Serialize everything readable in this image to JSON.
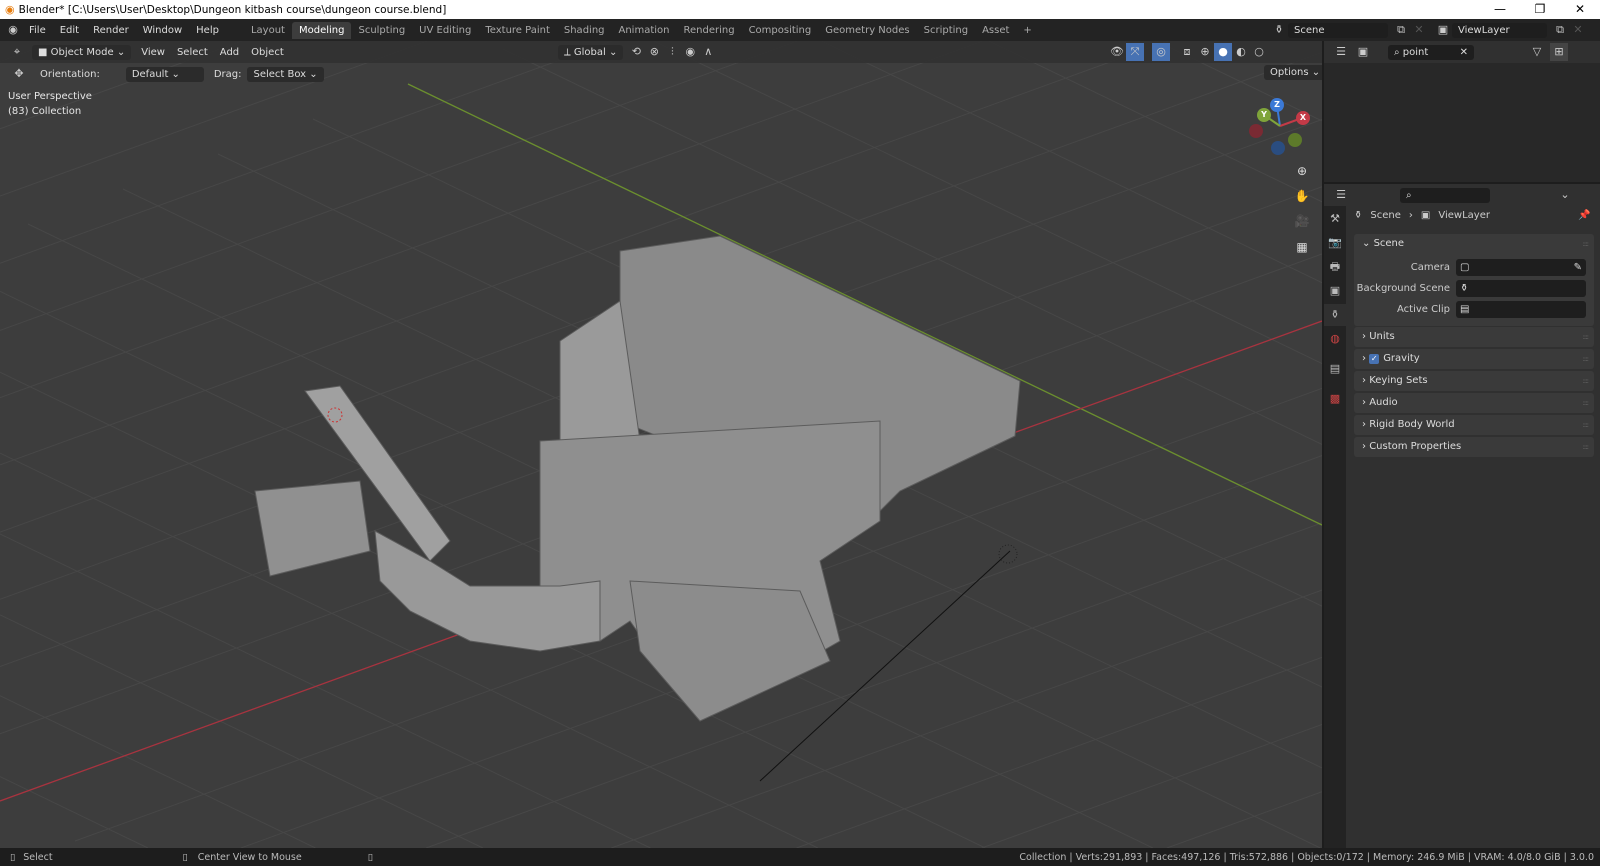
{
  "window": {
    "title": "Blender* [C:\\Users\\User\\Desktop\\Dungeon kitbash course\\dungeon course.blend]",
    "minimize": "—",
    "maximize": "❐",
    "close": "✕"
  },
  "menu": [
    "File",
    "Edit",
    "Render",
    "Window",
    "Help"
  ],
  "workspaces": [
    "Layout",
    "Modeling",
    "Sculpting",
    "UV Editing",
    "Texture Paint",
    "Shading",
    "Animation",
    "Rendering",
    "Compositing",
    "Geometry Nodes",
    "Scripting",
    "Asset",
    "+"
  ],
  "active_workspace": "Modeling",
  "scene": {
    "name": "Scene",
    "view_layer": "ViewLayer"
  },
  "viewport_header": {
    "mode": "Object Mode",
    "menus": [
      "View",
      "Select",
      "Add",
      "Object"
    ],
    "transform_orientation": "Global",
    "options": "Options"
  },
  "tool_settings": {
    "orientation_label": "Orientation:",
    "orientation_value": "Default",
    "drag_label": "Drag:",
    "drag_value": "Select Box"
  },
  "overlay": {
    "view": "User Perspective",
    "collection": "(83) Collection"
  },
  "gizmo": {
    "z": "Z",
    "y": "Y",
    "x": "X"
  },
  "outliner": {
    "search_value": "point"
  },
  "properties": {
    "breadcrumb": [
      "Scene",
      "ViewLayer"
    ],
    "scene_panel": {
      "title": "Scene",
      "fields": [
        {
          "label": "Camera",
          "value": ""
        },
        {
          "label": "Background Scene",
          "value": ""
        },
        {
          "label": "Active Clip",
          "value": ""
        }
      ]
    },
    "panels": [
      "Units",
      "Gravity",
      "Keying Sets",
      "Audio",
      "Rigid Body World",
      "Custom Properties"
    ],
    "gravity_checked": true
  },
  "status": {
    "select": "Select",
    "center": "Center View to Mouse",
    "stats": "Collection | Verts:291,893 | Faces:497,126 | Tris:572,886 | Objects:0/172 | Memory: 246.9 MiB | VRAM: 4.0/8.0 GiB | 3.0.0"
  },
  "colors": {
    "accent": "#4772b3",
    "x_axis": "#c33a47",
    "y_axis": "#7fa43a",
    "z_axis": "#3b79d6"
  }
}
